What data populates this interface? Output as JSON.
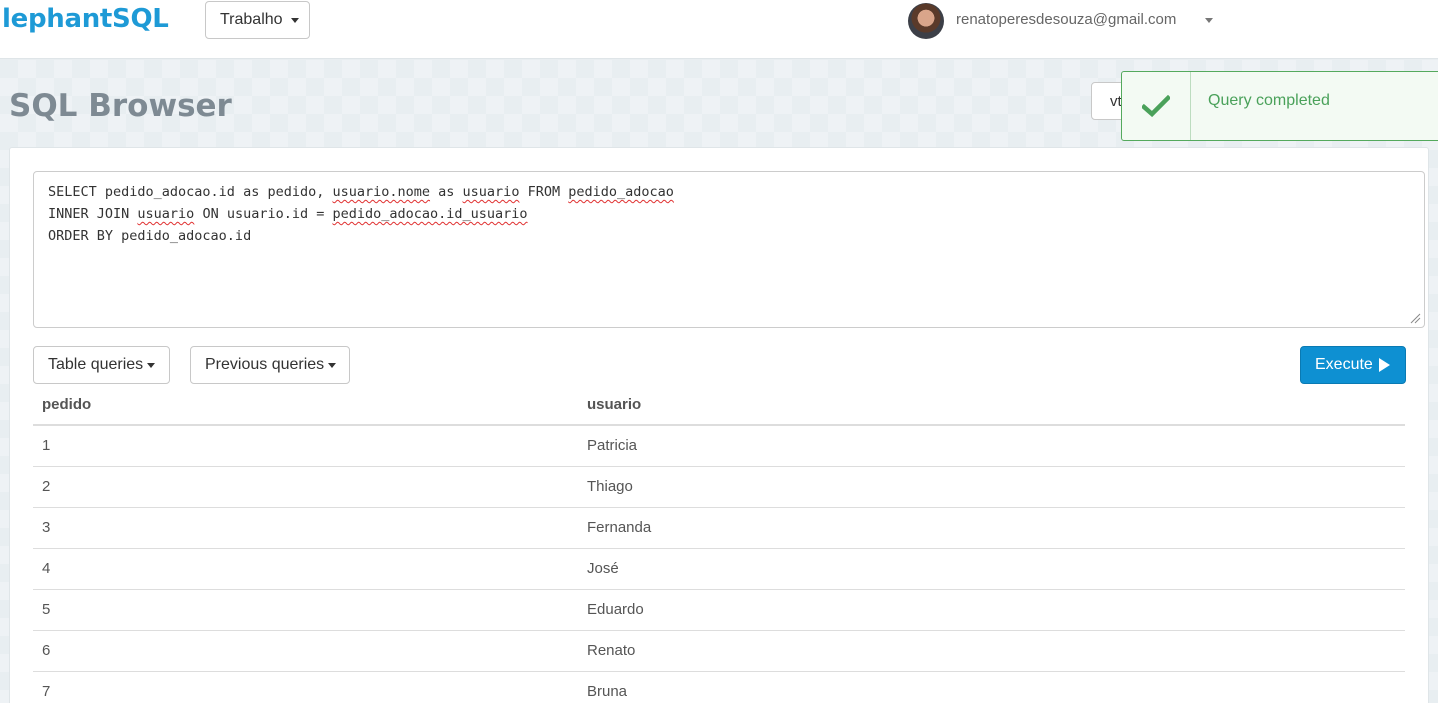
{
  "navbar": {
    "brand": "lephantSQL",
    "team_selector": "Trabalho",
    "user_email": "renatoperesdesouza@gmail.com"
  },
  "page": {
    "title": "SQL Browser",
    "db_selector_partial": "vt"
  },
  "toast": {
    "message": "Query completed",
    "color": "#4aa15a"
  },
  "editor": {
    "lines": [
      "SELECT pedido_adocao.id as pedido, usuario.nome as usuario FROM pedido_adocao",
      "INNER JOIN usuario ON usuario.id = pedido_adocao.id_usuario",
      "ORDER BY pedido_adocao.id"
    ]
  },
  "toolbar": {
    "table_queries": "Table queries",
    "previous_queries": "Previous queries",
    "execute": "Execute"
  },
  "results": {
    "columns": [
      "pedido",
      "usuario"
    ],
    "rows": [
      [
        "1",
        "Patricia"
      ],
      [
        "2",
        "Thiago"
      ],
      [
        "3",
        "Fernanda"
      ],
      [
        "4",
        "José"
      ],
      [
        "5",
        "Eduardo"
      ],
      [
        "6",
        "Renato"
      ],
      [
        "7",
        "Bruna"
      ]
    ]
  },
  "colors": {
    "brand": "#1e9ad6",
    "execute_button": "#0e90d2",
    "success": "#54a95d"
  }
}
